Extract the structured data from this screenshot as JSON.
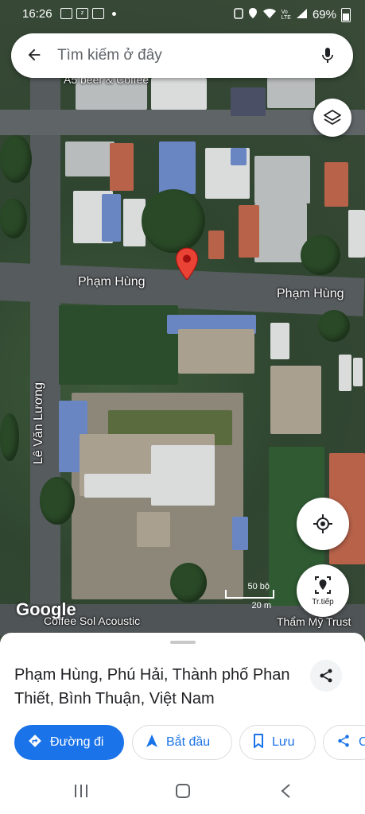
{
  "status_bar": {
    "time": "16:26",
    "battery": "69%",
    "notification_icons": [
      "message-icon",
      "zalo-icon",
      "gallery-icon",
      "dot-icon"
    ],
    "system_icons": [
      "nfc-icon",
      "location-icon",
      "wifi-icon",
      "volte-icon",
      "signal-icon",
      "battery-icon"
    ]
  },
  "search": {
    "placeholder": "Tìm kiếm ở đây"
  },
  "map": {
    "labels": {
      "poi_top": "A5 beer & Coffee",
      "street_left": "Phạm Hùng",
      "street_right": "Phạm Hùng",
      "street_vertical": "Lê Văn Lương",
      "poi_bottom_left": "Coffee Sol Acoustic",
      "poi_bottom_right": "Thẩm Mỹ Trust"
    },
    "scale": {
      "top": "50 bộ",
      "bottom": "20 m"
    },
    "attribution": "Google",
    "pin_color": "#ea4335"
  },
  "controls": {
    "navigate_label": "Tr.tiếp"
  },
  "sheet": {
    "place_title": "Phạm Hùng, Phú Hải, Thành phố Phan Thiết, Bình Thuận, Việt Nam",
    "actions": [
      {
        "label": "Đường đi",
        "icon": "directions-icon"
      },
      {
        "label": "Bắt đầu",
        "icon": "navigation-arrow-icon"
      },
      {
        "label": "Lưu",
        "icon": "bookmark-icon"
      },
      {
        "label": "C",
        "icon": "share-icon"
      }
    ]
  },
  "colors": {
    "accent": "#1a73e8",
    "pin": "#ea4335"
  }
}
